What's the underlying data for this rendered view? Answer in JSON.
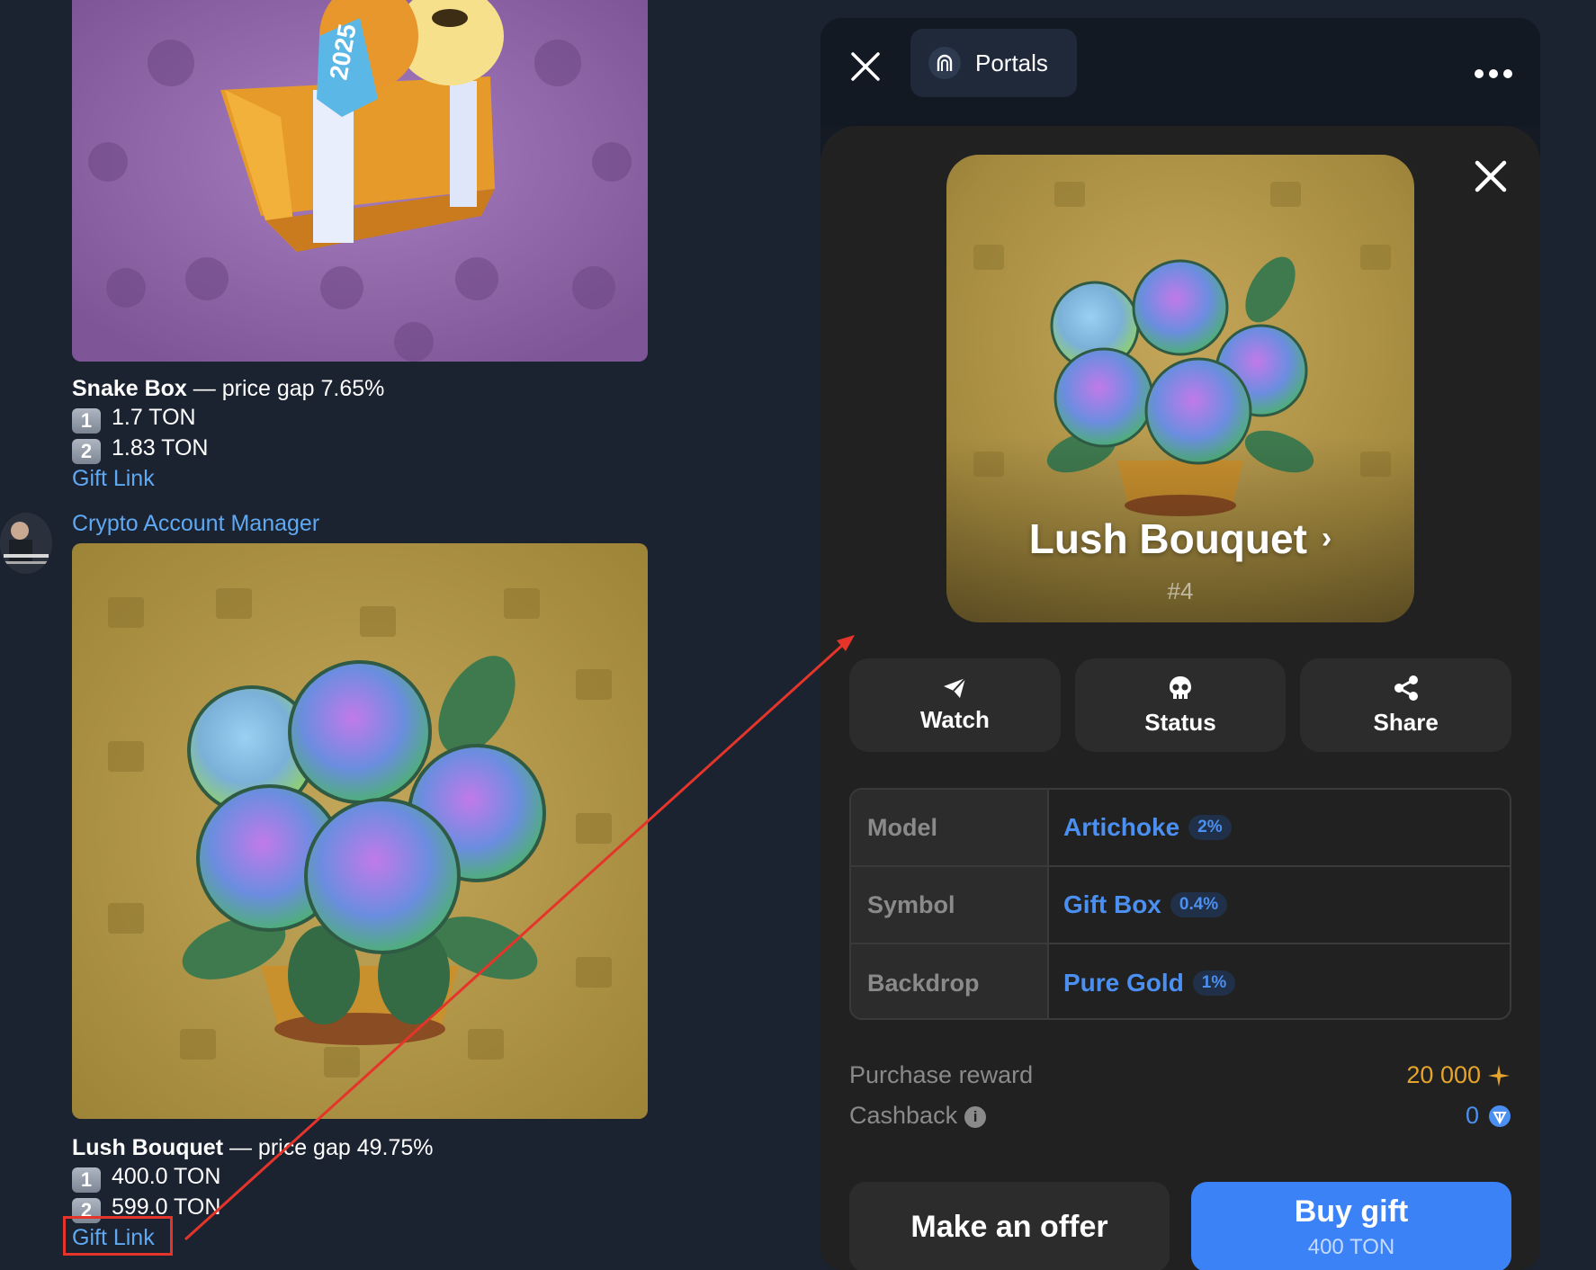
{
  "chat": {
    "messages": [
      {
        "gift_name": "Snake Box",
        "gap_text": " — price gap 7.65%",
        "price1": "1.7 TON",
        "price2": "1.83 TON",
        "link": "Gift Link",
        "image_label": "2025"
      },
      {
        "sender": "Crypto Account Manager",
        "gift_name": "Lush Bouquet",
        "gap_text": " — price gap 49.75%",
        "price1": "400.0 TON",
        "price2": "599.0 TON",
        "link": "Gift Link"
      }
    ],
    "key1": "1",
    "key2": "2"
  },
  "panel": {
    "app_name": "Portals",
    "gift": {
      "title": "Lush Bouquet",
      "number": "#4"
    },
    "actions": [
      {
        "label": "Watch",
        "icon": "paper-plane-icon"
      },
      {
        "label": "Status",
        "icon": "skull-icon"
      },
      {
        "label": "Share",
        "icon": "share-icon"
      }
    ],
    "attributes": [
      {
        "key": "Model",
        "value": "Artichoke",
        "percent": "2%"
      },
      {
        "key": "Symbol",
        "value": "Gift Box",
        "percent": "0.4%"
      },
      {
        "key": "Backdrop",
        "value": "Pure Gold",
        "percent": "1%"
      }
    ],
    "purchase_reward": {
      "label": "Purchase reward",
      "value": "20 000"
    },
    "cashback": {
      "label": "Cashback",
      "value": "0"
    },
    "offer_label": "Make an offer",
    "buy": {
      "label": "Buy gift",
      "price": "400 TON"
    }
  },
  "colors": {
    "accent": "#3b82f6",
    "link": "#5fa8f2",
    "reward": "#e5a52c",
    "annotation": "#e5352b"
  }
}
